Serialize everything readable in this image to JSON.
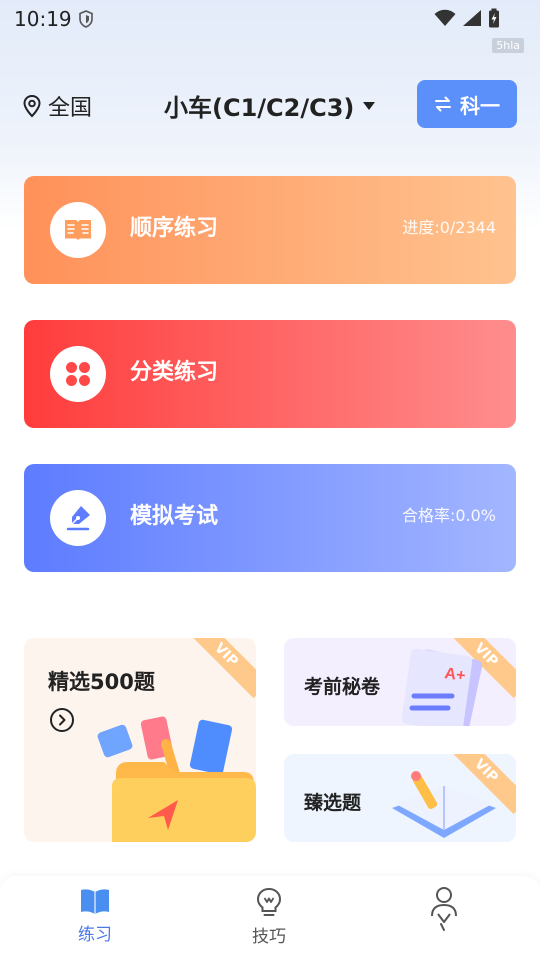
{
  "status_bar": {
    "time": "10:19"
  },
  "watermark": "5hla",
  "header": {
    "location": "全国",
    "car_type": "小车(C1/C2/C3)",
    "subject_button": "科一"
  },
  "cards": {
    "sequential": {
      "title": "顺序练习",
      "stat": "进度:0/2344"
    },
    "category": {
      "title": "分类练习"
    },
    "mock_exam": {
      "title": "模拟考试",
      "stat": "合格率:0.0%"
    }
  },
  "promos": {
    "selected_500": {
      "title": "精选500题",
      "badge": "VIP"
    },
    "pre_exam_secret": {
      "title": "考前秘卷",
      "badge": "VIP"
    },
    "curated": {
      "title": "臻选题",
      "badge": "VIP"
    }
  },
  "tabbar": {
    "practice": "练习",
    "tips": "技巧",
    "me": ""
  },
  "colors": {
    "accent": "#5b8ff9",
    "tab_active": "#4a78e8",
    "seq_gradient": [
      "#ff915a",
      "#ffc38f"
    ],
    "cat_gradient": [
      "#ff3c3c",
      "#ff8d8d"
    ],
    "exam_gradient": [
      "#5d7cff",
      "#a3b6ff"
    ]
  }
}
